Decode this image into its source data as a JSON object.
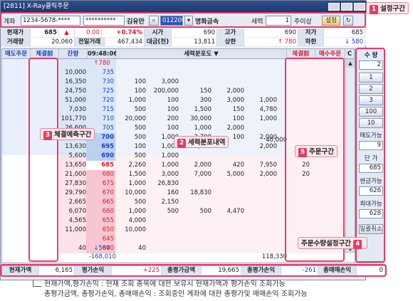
{
  "window": {
    "title": "[2811] X-Ray클릭주문"
  },
  "topbar": {
    "account_label": "계좌",
    "account_value": "1234-5678-****",
    "password_value": "**********",
    "owner": "김유안",
    "stock_code": "012200",
    "stock_name": "명화금속",
    "strength_label": "세력",
    "strength_value": "1",
    "period_label": "주이상",
    "settings_label": "설정"
  },
  "quote": {
    "row1": [
      {
        "k": "현재가",
        "v": "685"
      },
      {
        "k": "",
        "v": "▲"
      },
      {
        "k": "",
        "v": "0.00"
      },
      {
        "k": "",
        "v": "+0.74%"
      },
      {
        "k": "시가",
        "v": "690"
      },
      {
        "k": "고가",
        "v": "690"
      },
      {
        "k": "저가",
        "v": "685"
      }
    ],
    "row2": [
      {
        "k": "거래량",
        "v": "20,060"
      },
      {
        "k": "전일거래",
        "v": "467,434"
      },
      {
        "k": "대금(천)",
        "v": "13,811"
      },
      {
        "k": "상한",
        "v": "↑ 780"
      },
      {
        "k": "하한",
        "v": "↓ 580"
      }
    ]
  },
  "grid": {
    "headers": [
      "매도주문",
      "체결前",
      "잔량",
      "09:48:06",
      "세력분포도 ▼",
      "체결前",
      "매수주문",
      "C"
    ],
    "upper_limit": "↑780",
    "lower_limit": "↓580",
    "lower_diff": "-168,010",
    "total_right": "118,330",
    "sell_rows": [
      {
        "vol": "10,000",
        "price": "735",
        "d": [
          "",
          "",
          "",
          "",
          ""
        ]
      },
      {
        "vol": "16,350",
        "price": "730",
        "d": [
          "100",
          "3,000",
          "",
          "",
          ""
        ]
      },
      {
        "vol": "24,750",
        "price": "725",
        "d": [
          "100",
          "200,000",
          "150",
          "2,000",
          ""
        ]
      },
      {
        "vol": "51,000",
        "price": "720",
        "d": [
          "1,000",
          "100",
          "300",
          "3,000",
          "1,000"
        ]
      },
      {
        "vol": "7,030",
        "price": "715",
        "d": [
          "500",
          "100",
          "1,500",
          "150",
          "4,780"
        ]
      },
      {
        "vol": "101,770",
        "price": "710",
        "d": [
          "20,000",
          "200",
          "30,000",
          "100",
          "1,000"
        ]
      },
      {
        "vol": "26,600",
        "price": "705",
        "d": [
          "500",
          "100",
          "1,000",
          "2,000",
          ""
        ]
      },
      {
        "vol": "2,530",
        "price": "700",
        "d": [
          "500",
          "1,000",
          "2,700",
          "100",
          "2,000"
        ]
      },
      {
        "vol": "13,630",
        "price": "695",
        "d": [
          "100",
          "1,000",
          "5,000",
          "",
          "2,000"
        ]
      },
      {
        "vol": "5,600",
        "price": "690",
        "d": [
          "500",
          "1,000",
          "",
          "",
          ""
        ]
      }
    ],
    "sell_extra": "40,000",
    "buy_rows": [
      {
        "vol": "13,650",
        "price": "685",
        "d": [
          "2,260",
          "1,000",
          "2,000",
          "420",
          "7,950"
        ],
        "extra": "20"
      },
      {
        "vol": "21,000",
        "price": "680",
        "d": [
          "1,500",
          "3,000",
          "7,000",
          "5,000",
          "2,000"
        ],
        "extra": "20"
      },
      {
        "vol": "27,830",
        "price": "675",
        "d": [
          "1,000",
          "26,830",
          "",
          "",
          ""
        ],
        "extra": ""
      },
      {
        "vol": "29,790",
        "price": "670",
        "d": [
          "10,000",
          "160",
          "18,830",
          "",
          ""
        ],
        "extra": ""
      },
      {
        "vol": "2,665",
        "price": "665",
        "d": [
          "500",
          "2,150",
          "",
          "",
          ""
        ],
        "extra": ""
      },
      {
        "vol": "6,070",
        "price": "660",
        "d": [
          "1,000",
          "500",
          "500",
          "4,470",
          ""
        ],
        "extra": ""
      },
      {
        "vol": "4,565",
        "price": "655",
        "d": [
          "4,000",
          "",
          "",
          "",
          ""
        ],
        "extra": ""
      },
      {
        "vol": "11,000",
        "price": "650",
        "d": [
          "10,000",
          "",
          "",
          "",
          ""
        ],
        "extra": ""
      },
      {
        "vol": "",
        "price": "645",
        "d": [
          "",
          "",
          "",
          "",
          ""
        ],
        "extra": ""
      },
      {
        "vol": "40",
        "price": "640",
        "d": [
          "40",
          "",
          "",
          "",
          ""
        ],
        "extra": ""
      }
    ]
  },
  "side": {
    "qty_label": "수 량",
    "qty_value": "2",
    "presets": [
      "1",
      "2",
      "3",
      "100",
      "10"
    ],
    "sell_avail_label": "매도가능",
    "sell_avail": "9",
    "price_label": "단 가",
    "price": "685",
    "cash_label": "현금가능",
    "cash": "626",
    "max_label": "최대가능",
    "max": "628",
    "cancel_all": "일괄취소"
  },
  "bottom": {
    "items": [
      {
        "k": "현재가액",
        "v": "6,165"
      },
      {
        "k": "평가손익",
        "v": "+225"
      },
      {
        "k": "총평가금액",
        "v": "19,665"
      },
      {
        "k": "총평가손익",
        "v": "-261"
      },
      {
        "k": "총매매손익",
        "v": "0"
      }
    ]
  },
  "callouts": {
    "c1": "설정구간",
    "c2": "세력분포내역",
    "c3": "체결예측구간",
    "c4": "주문수량설정구간",
    "c5": "주문구간",
    "n1": "1",
    "n2": "2",
    "n3": "3",
    "n4": "4",
    "n5": "5"
  },
  "notes": {
    "line1": "현재가액,평가손익 : 현재 조회 종목에 대한 보유시 현재가액과 평가손익 조회가능",
    "line2": "총평가금액, 총평가손익, 총매매손익 : 조회중인 계좌에 대한 총평가및 매매손익 조회가능"
  }
}
